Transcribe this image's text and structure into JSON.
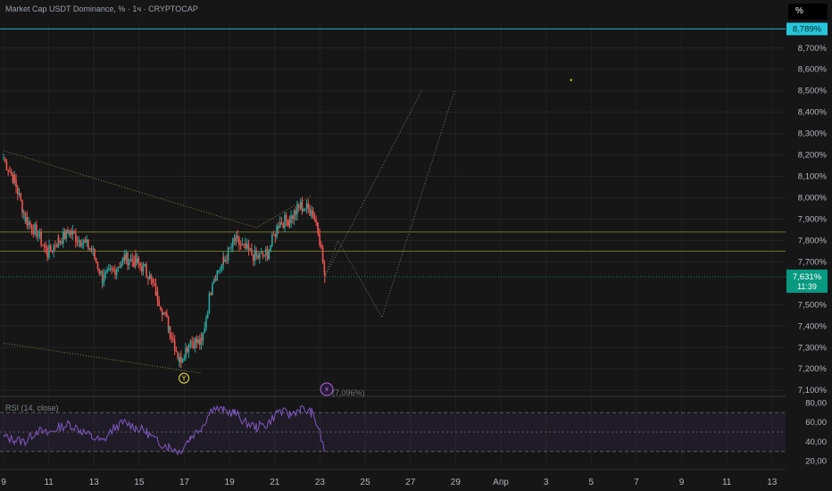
{
  "header": {
    "title": "Market Cap USDT Dominance, % · 1ч · CRYPTOCAP",
    "unit_button": "%"
  },
  "price_scale": {
    "labels": [
      "8,700%",
      "8,600%",
      "8,500%",
      "8,400%",
      "8,300%",
      "8,200%",
      "8,100%",
      "8,000%",
      "7,900%",
      "7,800%",
      "7,700%",
      "7,500%",
      "7,400%",
      "7,300%",
      "7,200%",
      "7,100%"
    ],
    "top_marker": "8,789%",
    "current_price": "7,631%",
    "countdown": "11:39"
  },
  "time_axis": {
    "labels": [
      "9",
      "11",
      "13",
      "15",
      "17",
      "19",
      "21",
      "23",
      "25",
      "27",
      "29",
      "Апр",
      "3",
      "5",
      "7",
      "9",
      "11",
      "13"
    ]
  },
  "annotations": {
    "low_marker": "Y",
    "low_value_label": "(7,096%)",
    "flash_icon": "⚡"
  },
  "rsi": {
    "label": "RSI (14, close)",
    "scale_labels": [
      "80,00",
      "60,00",
      "40,00",
      "20,00"
    ]
  },
  "colors": {
    "up": "#26a69a",
    "down": "#ef5350",
    "accent_cyan": "#26c6da",
    "price_tag": "#089981",
    "rsi_line": "#7e57c2",
    "level_olive": "#8a8a3a"
  },
  "chart_data": {
    "type": "candlestick",
    "symbol": "USDT.D",
    "interval": "1ч",
    "ylim": [
      7.08,
      8.82
    ],
    "close_series": [
      {
        "x": 9.0,
        "y": 8.18
      },
      {
        "x": 9.5,
        "y": 8.08
      },
      {
        "x": 10.0,
        "y": 7.9
      },
      {
        "x": 10.5,
        "y": 7.84
      },
      {
        "x": 11.0,
        "y": 7.74
      },
      {
        "x": 11.5,
        "y": 7.8
      },
      {
        "x": 12.0,
        "y": 7.84
      },
      {
        "x": 12.5,
        "y": 7.8
      },
      {
        "x": 13.0,
        "y": 7.76
      },
      {
        "x": 13.5,
        "y": 7.62
      },
      {
        "x": 14.0,
        "y": 7.66
      },
      {
        "x": 14.5,
        "y": 7.72
      },
      {
        "x": 15.0,
        "y": 7.7
      },
      {
        "x": 15.5,
        "y": 7.66
      },
      {
        "x": 16.0,
        "y": 7.54
      },
      {
        "x": 16.5,
        "y": 7.4
      },
      {
        "x": 17.0,
        "y": 7.24
      },
      {
        "x": 17.5,
        "y": 7.33
      },
      {
        "x": 18.0,
        "y": 7.32
      },
      {
        "x": 18.5,
        "y": 7.62
      },
      {
        "x": 19.0,
        "y": 7.7
      },
      {
        "x": 19.5,
        "y": 7.8
      },
      {
        "x": 20.0,
        "y": 7.76
      },
      {
        "x": 20.5,
        "y": 7.72
      },
      {
        "x": 21.0,
        "y": 7.74
      },
      {
        "x": 21.5,
        "y": 7.88
      },
      {
        "x": 22.0,
        "y": 7.9
      },
      {
        "x": 22.5,
        "y": 7.96
      },
      {
        "x": 23.0,
        "y": 7.94
      },
      {
        "x": 23.3,
        "y": 7.86
      },
      {
        "x": 23.6,
        "y": 7.63
      }
    ],
    "projection_path": [
      {
        "x": 23.6,
        "y": 7.63
      },
      {
        "x": 24.2,
        "y": 7.8
      },
      {
        "x": 26.2,
        "y": 7.44
      },
      {
        "x": 29.5,
        "y": 8.5
      }
    ],
    "projection_path_2": [
      {
        "x": 23.6,
        "y": 7.63
      },
      {
        "x": 28.0,
        "y": 8.5
      }
    ],
    "trendlines": [
      {
        "from": {
          "x": 9.0,
          "y": 8.22
        },
        "to": {
          "x": 20.5,
          "y": 7.86
        }
      },
      {
        "from": {
          "x": 9.0,
          "y": 7.32
        },
        "to": {
          "x": 18.0,
          "y": 7.18
        }
      },
      {
        "from": {
          "x": 20.5,
          "y": 7.86
        },
        "to": {
          "x": 23.0,
          "y": 8.01
        }
      }
    ],
    "levels": [
      {
        "y": 8.789
      },
      {
        "y": 7.84
      },
      {
        "y": 7.75
      },
      {
        "y": 7.631
      }
    ],
    "low_point": {
      "x": 17.2,
      "y": 7.19
    },
    "marker_dot": {
      "x": 34.8,
      "y": 8.55
    },
    "rsi_series": [
      {
        "x": 9.0,
        "y": 45
      },
      {
        "x": 9.5,
        "y": 42
      },
      {
        "x": 10.0,
        "y": 40
      },
      {
        "x": 10.5,
        "y": 52
      },
      {
        "x": 11.0,
        "y": 48
      },
      {
        "x": 11.5,
        "y": 55
      },
      {
        "x": 12.0,
        "y": 58
      },
      {
        "x": 12.5,
        "y": 52
      },
      {
        "x": 13.0,
        "y": 45
      },
      {
        "x": 13.5,
        "y": 40
      },
      {
        "x": 14.0,
        "y": 54
      },
      {
        "x": 14.5,
        "y": 60
      },
      {
        "x": 15.0,
        "y": 55
      },
      {
        "x": 15.5,
        "y": 50
      },
      {
        "x": 16.0,
        "y": 40
      },
      {
        "x": 16.5,
        "y": 35
      },
      {
        "x": 17.0,
        "y": 30
      },
      {
        "x": 17.5,
        "y": 45
      },
      {
        "x": 18.0,
        "y": 55
      },
      {
        "x": 18.5,
        "y": 75
      },
      {
        "x": 19.0,
        "y": 72
      },
      {
        "x": 19.5,
        "y": 70
      },
      {
        "x": 20.0,
        "y": 60
      },
      {
        "x": 20.5,
        "y": 55
      },
      {
        "x": 21.0,
        "y": 58
      },
      {
        "x": 21.5,
        "y": 72
      },
      {
        "x": 22.0,
        "y": 68
      },
      {
        "x": 22.5,
        "y": 74
      },
      {
        "x": 23.0,
        "y": 70
      },
      {
        "x": 23.3,
        "y": 55
      },
      {
        "x": 23.6,
        "y": 30
      }
    ],
    "rsi_ylim": [
      15,
      85
    ]
  }
}
